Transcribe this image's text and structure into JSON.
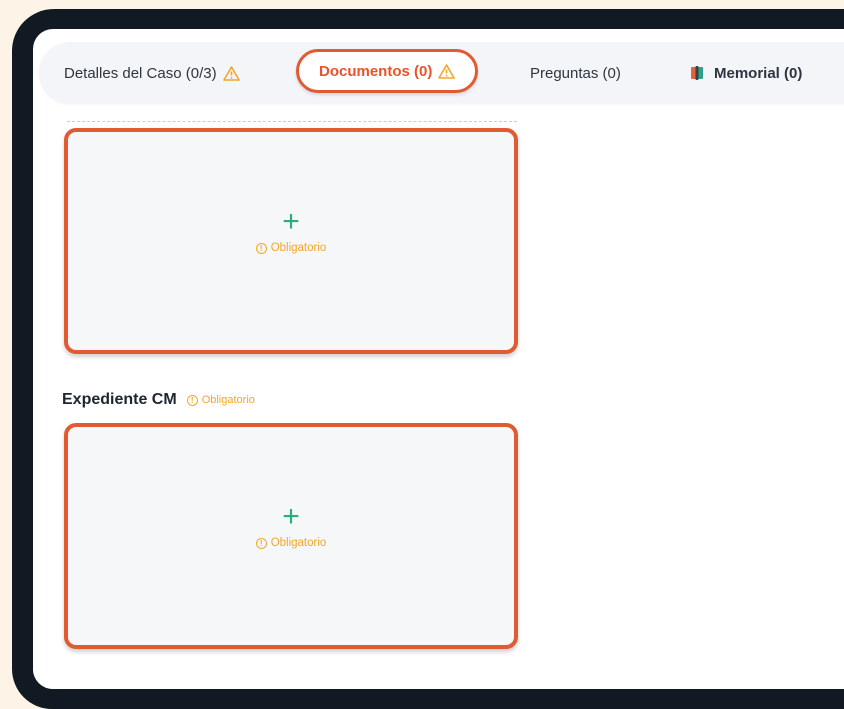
{
  "tabs": [
    {
      "label": "Detalles del Caso (0/3)",
      "warning": true
    },
    {
      "label": "Documentos (0)",
      "warning": true,
      "active": true
    },
    {
      "label": "Preguntas (0)",
      "warning": false
    },
    {
      "label": "Memorial (0)",
      "icon": "book-icon",
      "warning": false
    }
  ],
  "uploads": [
    {
      "plus": "+",
      "required_label": "Obligatorio"
    },
    {
      "plus": "+",
      "required_label": "Obligatorio"
    }
  ],
  "sections": [
    {
      "title": "Expediente CM",
      "required_label": "Obligatorio"
    }
  ],
  "colors": {
    "accent": "#e05a32",
    "active_tab_text": "#e9532a",
    "plus": "#22b07d",
    "required": "#f2a72a",
    "page_bg": "#fdf3e6",
    "frame": "#111a22"
  }
}
